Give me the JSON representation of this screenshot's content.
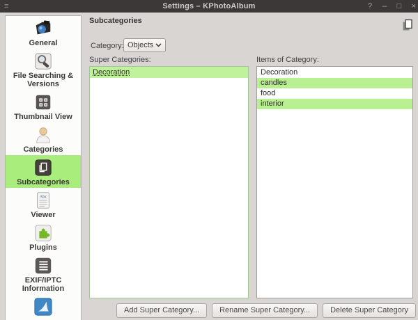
{
  "titlebar": {
    "title": "Settings – KPhotoAlbum",
    "menu_glyph": "≡",
    "controls": {
      "help": "?",
      "minimize": "–",
      "maximize": "□",
      "close": "×"
    }
  },
  "sidebar": {
    "items": [
      {
        "label": "General",
        "icon": "camera-icon",
        "selected": false
      },
      {
        "label": "File Searching & Versions",
        "icon": "search-icon",
        "selected": false
      },
      {
        "label": "Thumbnail View",
        "icon": "thumbnail-grid-icon",
        "selected": false
      },
      {
        "label": "Categories",
        "icon": "person-icon",
        "selected": false
      },
      {
        "label": "Subcategories",
        "icon": "stacked-pages-icon",
        "selected": true
      },
      {
        "label": "Viewer",
        "icon": "abc-document-icon",
        "selected": false
      },
      {
        "label": "Plugins",
        "icon": "puzzle-icon",
        "selected": false
      },
      {
        "label": "EXIF/IPTC Information",
        "icon": "list-lines-icon",
        "selected": false
      },
      {
        "label": "",
        "icon": "blue-fin-icon",
        "selected": false
      }
    ]
  },
  "main": {
    "page_title": "Subcategories",
    "corner_icon": "stacked-pages-outline-icon",
    "category_label": "Category:",
    "category_value": "Objects",
    "super_categories_label": "Super Categories:",
    "items_of_category_label": "Items of Category:",
    "super_categories": [
      {
        "label": "Decoration",
        "selected": true
      }
    ],
    "category_items": [
      {
        "label": "Decoration",
        "selected": false
      },
      {
        "label": "candles",
        "selected": true
      },
      {
        "label": "food",
        "selected": false
      },
      {
        "label": "interior",
        "selected": true
      }
    ],
    "buttons": {
      "add": "Add Super Category...",
      "rename": "Rename Super Category...",
      "delete": "Delete Super Category"
    }
  },
  "colors": {
    "titlebar_bg": "#3b3837",
    "window_bg": "#d8d5d2",
    "sidebar_selection_green": "#a9ee7c",
    "list_selection_green": "#b9f192",
    "plugin_green": "#76b82a",
    "focused_list_border": "#a3c794"
  }
}
